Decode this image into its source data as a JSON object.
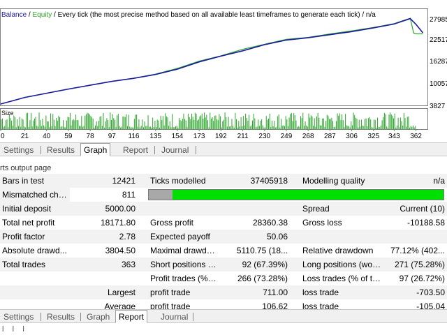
{
  "chart": {
    "legend_balance": "Balance",
    "legend_sep1": " / ",
    "legend_equity": "Equity",
    "legend_rest": " / Every tick (the most precise method based on all available least timeframes to generate each tick) / n/a",
    "size_label": "Size",
    "y_ticks": [
      "27985",
      "22517",
      "16287",
      "10057",
      "3827"
    ],
    "x_ticks": [
      "0",
      "21",
      "40",
      "59",
      "78",
      "97",
      "116",
      "135",
      "154",
      "173",
      "192",
      "211",
      "230",
      "249",
      "268",
      "287",
      "306",
      "325",
      "343",
      "362"
    ],
    "colors": {
      "balance": "#1a1a9e",
      "equity": "#2aa52a",
      "volume": "#2aa52a"
    }
  },
  "chart_data": {
    "type": "line",
    "ylim": [
      3827,
      29000
    ],
    "xlim": [
      0,
      372
    ],
    "series": [
      {
        "name": "Balance",
        "x": [
          0,
          10,
          21,
          40,
          59,
          78,
          97,
          116,
          135,
          154,
          173,
          192,
          211,
          230,
          249,
          268,
          287,
          306,
          325,
          343,
          350,
          357,
          362,
          368
        ],
        "values": [
          4200,
          5000,
          5900,
          7000,
          8100,
          9100,
          10100,
          10900,
          11900,
          13300,
          15200,
          16700,
          18100,
          19700,
          20900,
          21500,
          22300,
          23100,
          24100,
          25100,
          25800,
          26500,
          25000,
          22800
        ]
      },
      {
        "name": "Equity",
        "x": [
          0,
          10,
          21,
          40,
          59,
          78,
          97,
          116,
          135,
          154,
          173,
          192,
          211,
          230,
          249,
          268,
          287,
          306,
          325,
          343,
          350,
          357,
          360,
          362,
          368
        ],
        "values": [
          4200,
          5000,
          5900,
          7000,
          8100,
          9100,
          10100,
          10900,
          12000,
          13500,
          15400,
          16800,
          18500,
          19800,
          21100,
          21600,
          22500,
          23300,
          24200,
          25200,
          25900,
          26600,
          22700,
          22517,
          22517
        ]
      }
    ]
  },
  "tabs_top": [
    {
      "label": "Settings"
    },
    {
      "label": "Results"
    },
    {
      "label": "Graph",
      "active": true
    },
    {
      "label": "Report"
    },
    {
      "label": "Journal"
    }
  ],
  "tabs_bottom": [
    {
      "label": "Settings"
    },
    {
      "label": "Results"
    },
    {
      "label": "Graph"
    },
    {
      "label": "Report",
      "active": true
    },
    {
      "label": "Journal"
    }
  ],
  "caption": "rts output page",
  "report": {
    "bars_in_test_label": "Bars in test",
    "bars_in_test": "12421",
    "ticks_modelled_label": "Ticks modelled",
    "ticks_modelled": "37405918",
    "modelling_quality_label": "Modelling quality",
    "modelling_quality": "n/a",
    "mismatched_label": "Mismatched cha...",
    "mismatched": "811",
    "quality_bar_fraction": 0.08,
    "initial_deposit_label": "Initial deposit",
    "initial_deposit": "5000.00",
    "spread_label": "Spread",
    "spread": "Current (10)",
    "total_net_profit_label": "Total net profit",
    "total_net_profit": "18171.80",
    "gross_profit_label": "Gross profit",
    "gross_profit": "28360.38",
    "gross_loss_label": "Gross loss",
    "gross_loss": "-10188.58",
    "profit_factor_label": "Profit factor",
    "profit_factor": "2.78",
    "expected_payoff_label": "Expected payoff",
    "expected_payoff": "50.06",
    "absolute_drawdown_label": "Absolute drawd...",
    "absolute_drawdown": "3804.50",
    "maximal_drawdown_label": "Maximal drawdown",
    "maximal_drawdown": "5110.75 (18...",
    "relative_drawdown_label": "Relative drawdown",
    "relative_drawdown": "77.12% (402...",
    "total_trades_label": "Total trades",
    "total_trades": "363",
    "short_positions_label": "Short positions (won...",
    "short_positions": "92 (67.39%)",
    "long_positions_label": "Long positions (won...",
    "long_positions": "271 (75.28%)",
    "profit_trades_label": "Profit trades (% of to...",
    "profit_trades": "266 (73.28%)",
    "loss_trades_label": "Loss trades (% of total)",
    "loss_trades": "97 (26.72%)",
    "largest_label": "Largest",
    "largest_profit_label": "profit trade",
    "largest_profit": "711.00",
    "largest_loss_label": "loss trade",
    "largest_loss": "-703.50",
    "average_label": "Average",
    "average_profit_label": "profit trade",
    "average_profit": "106.62",
    "average_loss_label": "loss trade",
    "average_loss": "-105.04"
  },
  "footer_text": "l    l    l"
}
